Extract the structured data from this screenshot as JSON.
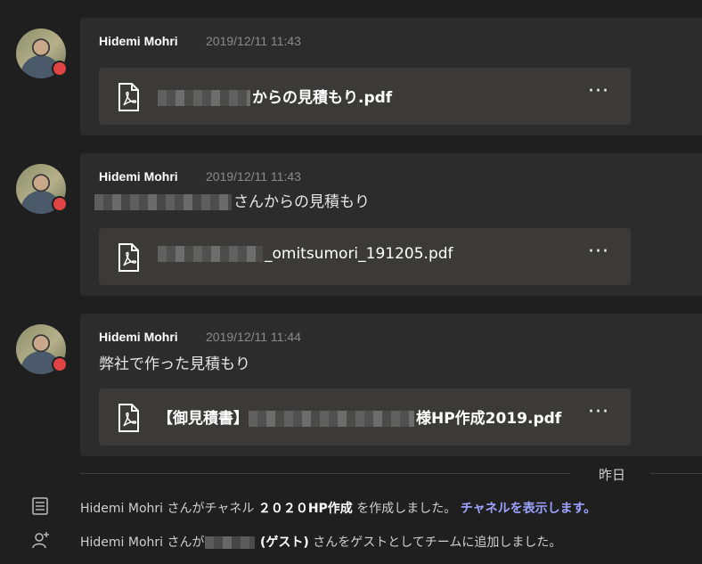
{
  "messages": [
    {
      "author": "Hidemi Mohri",
      "time": "2019/12/11 11:43",
      "text": "",
      "file": {
        "name_suffix": "からの見積もり.pdf",
        "icon": "pdf-file-icon",
        "more": "···"
      }
    },
    {
      "author": "Hidemi Mohri",
      "time": "2019/12/11 11:43",
      "text": "さんからの見積もり",
      "file": {
        "name_suffix": "_omitsumori_191205.pdf",
        "icon": "pdf-file-icon",
        "more": "···"
      }
    },
    {
      "author": "Hidemi Mohri",
      "time": "2019/12/11 11:44",
      "text": "弊社で作った見積もり",
      "file": {
        "name_prefix": "【御見積書】",
        "name_suffix": "様HP作成2019.pdf",
        "icon": "pdf-file-icon",
        "more": "···"
      }
    }
  ],
  "date_divider": "昨日",
  "system": [
    {
      "icon": "channel-icon",
      "pre": "Hidemi Mohri さんがチャネル ",
      "channel": "２０２０HP作成",
      "mid": " を作成しました。 ",
      "link": "チャネルを表示します。"
    },
    {
      "icon": "add-guest-icon",
      "pre": "Hidemi Mohri さんが",
      "guest": "(ゲスト)",
      "post": " さんをゲストとしてチームに追加しました。"
    }
  ],
  "colors": {
    "background": "#1f1f1f",
    "card": "#2d2c2c",
    "file_card": "#3b3a39",
    "presence_busy": "#e04343",
    "link": "#9ea2ff"
  }
}
